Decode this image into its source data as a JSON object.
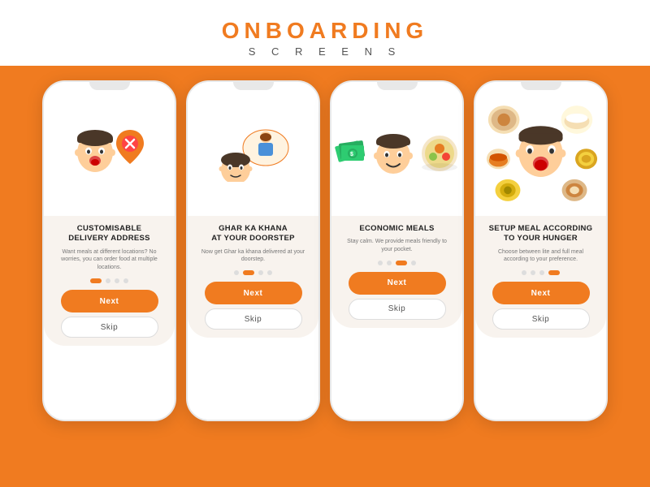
{
  "header": {
    "title": "ONBOARDING",
    "subtitle": "S C R E E N S"
  },
  "screens": [
    {
      "id": "screen1",
      "title": "CUSTOMISABLE\nDELIVERY ADDRESS",
      "description": "Want meals at different locations? No worries, you can order food at multiple locations.",
      "active_dot": 0,
      "next_label": "Next",
      "skip_label": "Skip"
    },
    {
      "id": "screen2",
      "title": "GHAR KA KHANA\nAT YOUR DOORSTEP",
      "description": "Now get Ghar ka khana delivered at your doorstep.",
      "active_dot": 1,
      "next_label": "Next",
      "skip_label": "Skip"
    },
    {
      "id": "screen3",
      "title": "ECONOMIC MEALS",
      "description": "Stay calm. We provide meals friendly to your pocket.",
      "active_dot": 2,
      "next_label": "Next",
      "skip_label": "Skip"
    },
    {
      "id": "screen4",
      "title": "SETUP MEAL ACCORDING\nTO YOUR HUNGER",
      "description": "Choose between lite and full meal according to your preference.",
      "active_dot": 3,
      "next_label": "Next",
      "skip_label": "Skip"
    }
  ],
  "dots_count": 4
}
